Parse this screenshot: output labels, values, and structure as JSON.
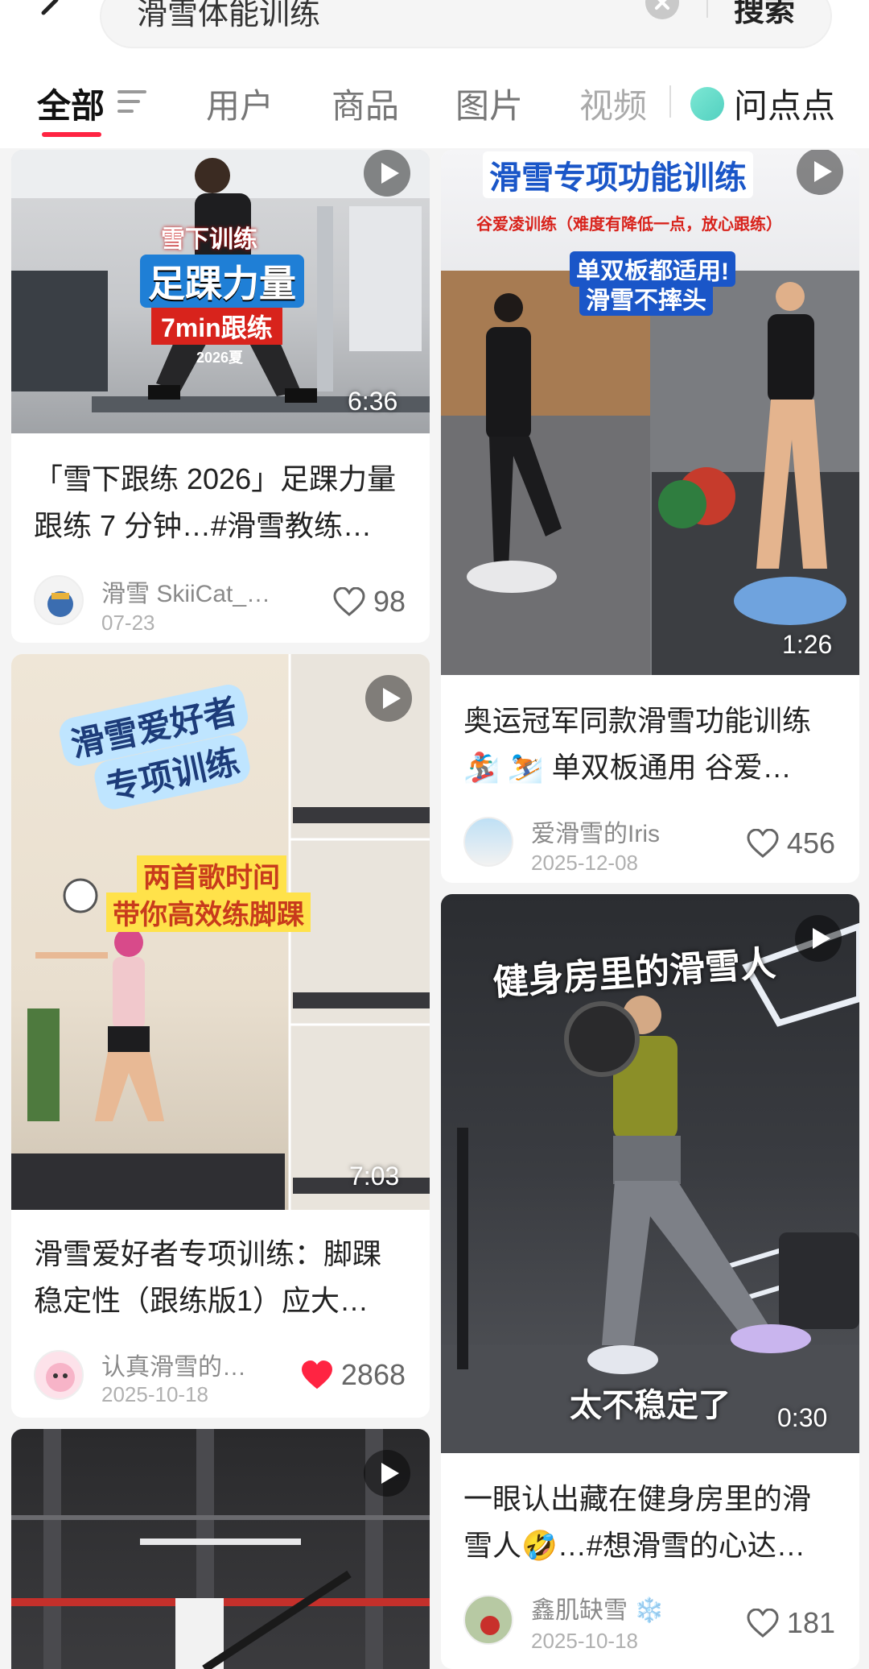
{
  "search": {
    "query": "滑雪体能训练",
    "button_label": "搜索"
  },
  "tabs": [
    {
      "label": "全部",
      "active": true
    },
    {
      "label": "用户"
    },
    {
      "label": "商品"
    },
    {
      "label": "图片"
    },
    {
      "label": "视频"
    },
    {
      "label": "问点点"
    }
  ],
  "colors": {
    "accent": "#ff2442",
    "like_active": "#ff2442"
  },
  "cards": [
    {
      "overlay": {
        "line1": "雪下训练",
        "line2": "足踝力量",
        "line3": "7min跟练",
        "line4": "2026夏"
      },
      "duration": "6:36",
      "title_line1": "「雪下跟练 2026」足踝力量",
      "title_line2": "跟练 7 分钟…#滑雪教练…",
      "author": "滑雪 SkiiCat_…",
      "date": "07-23",
      "likes": "98",
      "liked": false
    },
    {
      "overlay": {
        "line1": "滑雪专项功能训练",
        "line2": "谷爱凌训练（难度有降低一点，放心跟练）",
        "line3": "单双板都适用!",
        "line4": "滑雪不摔头"
      },
      "duration": "1:26",
      "title_line1": "奥运冠军同款滑雪功能训练",
      "title_line2": "🏂 ⛷️ 单双板通用 谷爱…",
      "author": "爱滑雪的Iris",
      "date": "2025-12-08",
      "likes": "456",
      "liked": false
    },
    {
      "overlay": {
        "line1": "滑雪爱好者",
        "line2": "专项训练",
        "line3": "两首歌时间",
        "line4": "带你高效练脚踝"
      },
      "duration": "7:03",
      "title_line1": "滑雪爱好者专项训练：脚踝",
      "title_line2": "稳定性（跟练版1）应大…",
      "author": "认真滑雪的…",
      "date": "2025-10-18",
      "likes": "2868",
      "liked": true
    },
    {
      "overlay": {
        "line1": "健身房里的滑雪人",
        "line2": "太不稳定了"
      },
      "duration": "0:30",
      "title_line1": "一眼认出藏在健身房里的滑",
      "title_line2": "雪人🤣…#想滑雪的心达…",
      "author": "鑫肌缺雪 ❄️",
      "date": "2025-10-18",
      "likes": "181",
      "liked": false
    }
  ]
}
